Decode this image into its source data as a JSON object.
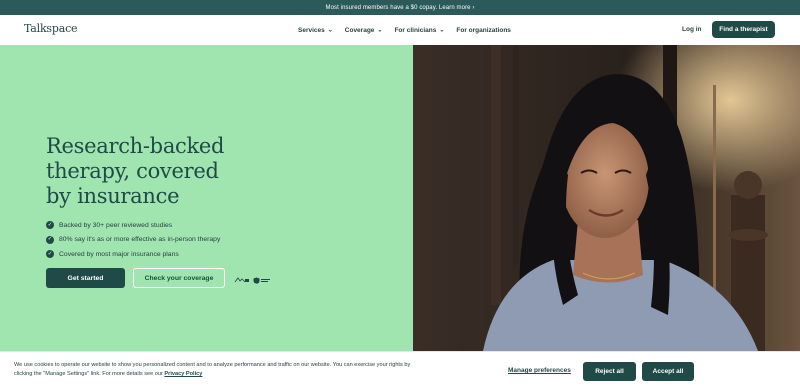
{
  "announcement": {
    "text": "Most insured members have a $0 copay. Learn more ›"
  },
  "nav": {
    "logo": "Talkspace",
    "menu": [
      {
        "label": "Services",
        "has_dropdown": true
      },
      {
        "label": "Coverage",
        "has_dropdown": true
      },
      {
        "label": "For clinicians",
        "has_dropdown": true
      },
      {
        "label": "For organizations",
        "has_dropdown": false
      }
    ],
    "chevron": "⌄",
    "login": "Log in",
    "cta": "Find a therapist"
  },
  "hero": {
    "title_lines": [
      "Research-backed",
      "therapy, covered",
      "by insurance"
    ],
    "bullets": [
      "Backed by 30+ peer reviewed studies",
      "80% say it's as or more effective as in-person therapy",
      "Covered by most major insurance plans"
    ],
    "check_glyph": "✓",
    "primary_button": "Get started",
    "secondary_button": "Check your coverage",
    "badge_icons": [
      "apa-badge-icon",
      "shield-badge-icon"
    ],
    "image_alt_icon": "smiling-woman-photo"
  },
  "cookie_banner": {
    "text": "We use cookies to operate our website to show you personalized content and to analyze performance and traffic on our website. You can exercise your rights by clicking the \"Manage Settings\" link. For more details see our",
    "privacy_link": "Privacy Policy",
    "manage": "Manage preferences",
    "reject": "Reject all",
    "accept": "Accept all"
  },
  "colors": {
    "brand_dark_green": "#1f4a47",
    "announcement_bg": "#2a5a59",
    "hero_mint": "#a0e4b0",
    "white": "#ffffff"
  }
}
